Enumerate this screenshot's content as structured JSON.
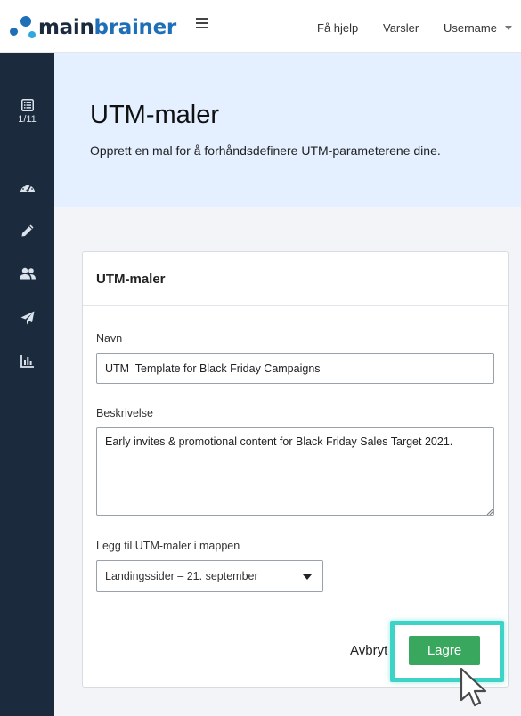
{
  "header": {
    "logo_main": "main",
    "logo_brainer": "brainer",
    "nav": {
      "help": "Få hjelp",
      "alerts": "Varsler",
      "user": "Username"
    }
  },
  "sidebar": {
    "counter": "1/11",
    "items": [
      {
        "icon": "list-icon"
      },
      {
        "icon": "dashboard-gauge-icon"
      },
      {
        "icon": "pencil-icon"
      },
      {
        "icon": "users-icon"
      },
      {
        "icon": "paper-plane-icon"
      },
      {
        "icon": "bar-chart-icon"
      }
    ]
  },
  "page": {
    "title": "UTM-maler",
    "subtitle": "Opprett en mal for å forhåndsdefinere UTM-parameterene dine."
  },
  "form": {
    "card_title": "UTM-maler",
    "name_label": "Navn",
    "name_value": "UTM  Template for Black Friday Campaigns",
    "description_label": "Beskrivelse",
    "description_value": "Early invites & promotional content for Black Friday Sales Target 2021.",
    "folder_label": "Legg til UTM-maler i mappen",
    "folder_value": "Landingssider – 21. september",
    "cancel_label": "Avbryt",
    "save_label": "Lagre"
  },
  "colors": {
    "sidebar": "#1c2a3d",
    "banner": "#e4efff",
    "brand_blue": "#1e6fb8",
    "save_green": "#39a75d",
    "highlight_teal": "#3dd3c6"
  }
}
